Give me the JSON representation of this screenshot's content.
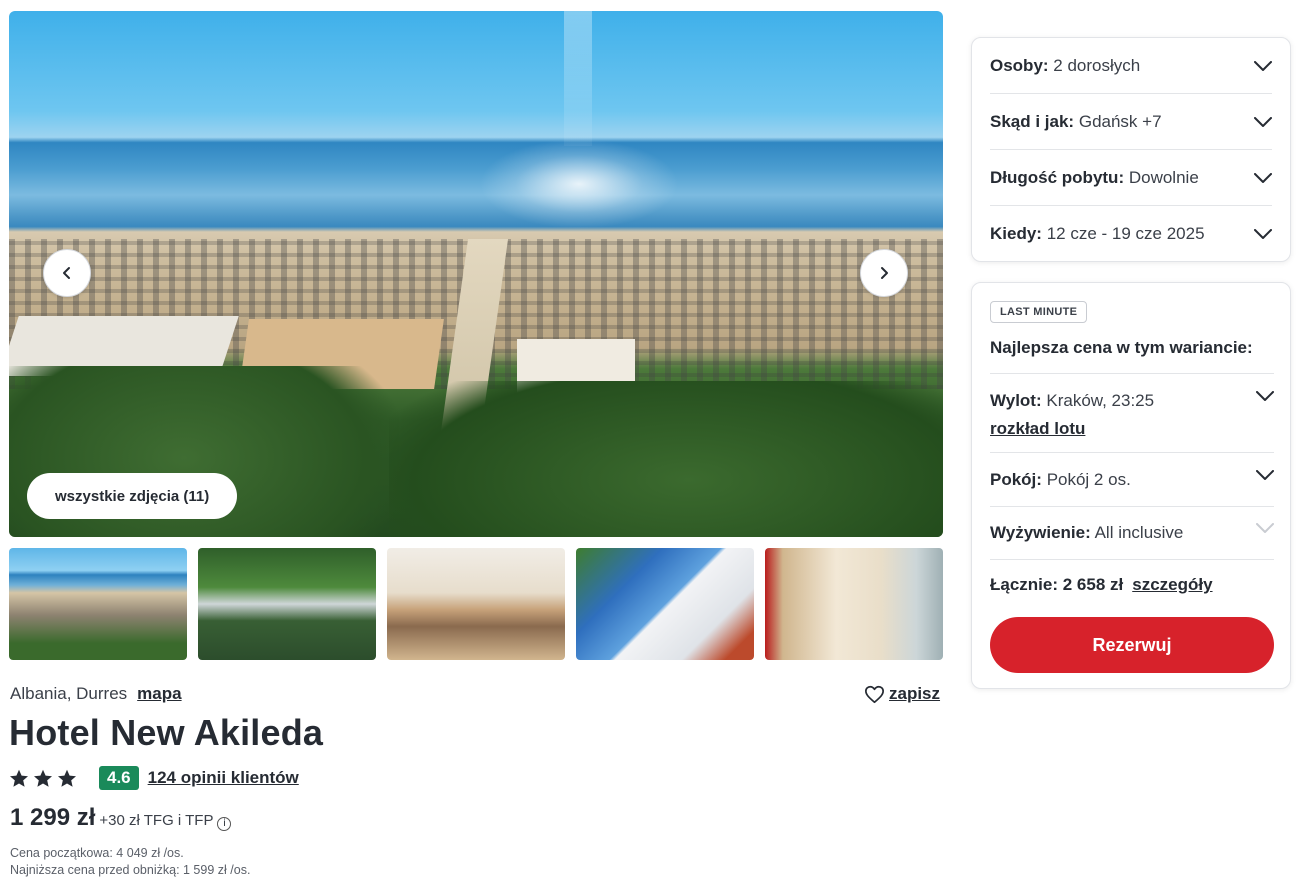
{
  "gallery": {
    "all_photos_label": "wszystkie zdjęcia (11)",
    "thumbnails": [
      "beach",
      "restaurant-garden",
      "dining-room",
      "hotel-building",
      "hotel-room"
    ]
  },
  "hotel": {
    "location": "Albania, Durres",
    "map_label": "mapa",
    "save_label": "zapisz",
    "name": "Hotel New Akileda",
    "stars": 3,
    "score": "4.6",
    "reviews_label": "124 opinii klientów",
    "price": "1 299 zł",
    "price_extra": "+30 zł TFG i TFP",
    "initial_price_note": "Cena początkowa: 4 049 zł /os.",
    "lowest_price_note": "Najniższa cena przed obniżką: 1 599 zł /os.",
    "score_color": "#1a8a5a"
  },
  "filters": {
    "persons": {
      "label": "Osoby:",
      "value": "2 dorosłych"
    },
    "from": {
      "label": "Skąd i jak:",
      "value": "Gdańsk +7"
    },
    "duration": {
      "label": "Długość pobytu:",
      "value": "Dowolnie"
    },
    "when": {
      "label": "Kiedy:",
      "value": "12 cze - 19 cze 2025"
    }
  },
  "booking": {
    "badge": "LAST MINUTE",
    "best_price_title": "Najlepsza cena w tym wariancie:",
    "flight": {
      "label": "Wylot:",
      "value": "Kraków, 23:25",
      "link": "rozkład lotu"
    },
    "room": {
      "label": "Pokój:",
      "value": "Pokój 2 os."
    },
    "board": {
      "label": "Wyżywienie:",
      "value": "All inclusive"
    },
    "total": {
      "label": "Łącznie: 2 658 zł",
      "details_link": "szczegóły"
    },
    "reserve_label": "Rezerwuj",
    "accent_color": "#d7222b"
  }
}
